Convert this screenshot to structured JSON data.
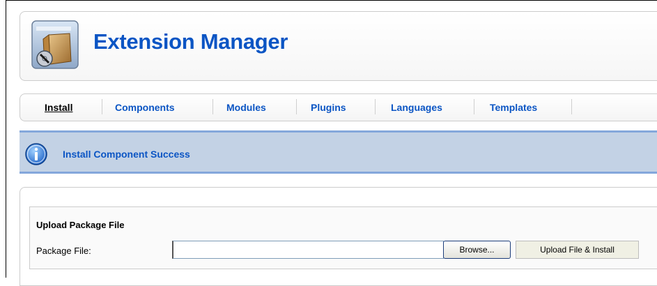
{
  "header": {
    "title": "Extension Manager",
    "icon": "extension-package-icon"
  },
  "tabs": [
    {
      "label": "Install",
      "active": true
    },
    {
      "label": "Components",
      "active": false
    },
    {
      "label": "Modules",
      "active": false
    },
    {
      "label": "Plugins",
      "active": false
    },
    {
      "label": "Languages",
      "active": false
    },
    {
      "label": "Templates",
      "active": false
    }
  ],
  "message": {
    "icon": "info-icon",
    "text": "Install Component Success"
  },
  "upload": {
    "heading": "Upload Package File",
    "file_label": "Package File:",
    "file_value": "",
    "browse_label": "Browse...",
    "install_label": "Upload File & Install"
  },
  "colors": {
    "link_blue": "#0b55c4",
    "message_bg": "#c3d2e5",
    "message_border": "#84a7db"
  }
}
